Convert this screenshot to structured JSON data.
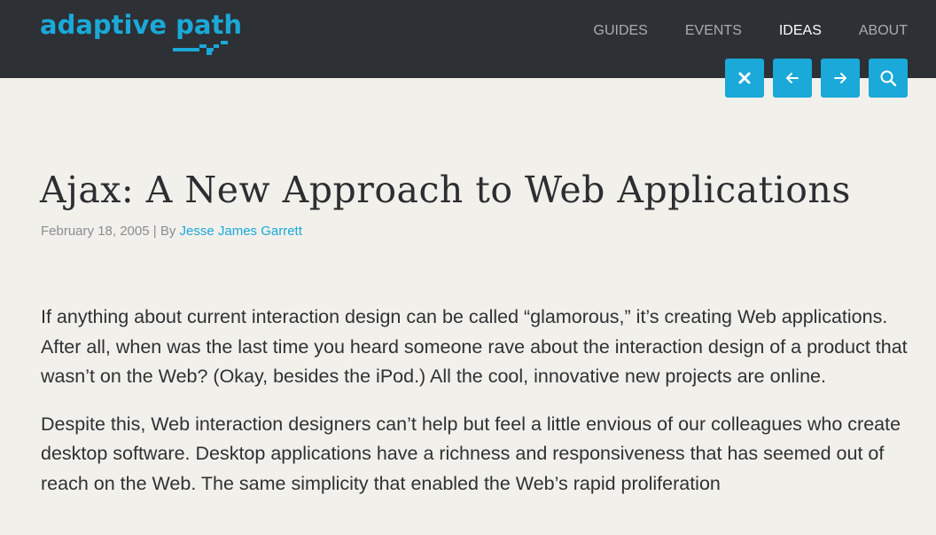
{
  "header": {
    "logo_text": "adaptive path",
    "nav": [
      {
        "label": "GUIDES",
        "active": false
      },
      {
        "label": "EVENTS",
        "active": false
      },
      {
        "label": "IDEAS",
        "active": true
      },
      {
        "label": "ABOUT",
        "active": false
      }
    ],
    "tools": [
      {
        "icon": "close-icon"
      },
      {
        "icon": "arrow-left-icon"
      },
      {
        "icon": "arrow-right-icon"
      },
      {
        "icon": "search-icon"
      }
    ]
  },
  "article": {
    "title": "Ajax: A New Approach to Web Applications",
    "date": "February 18, 2005",
    "separator": "| By",
    "author": "Jesse James Garrett",
    "paragraphs": [
      "If anything about current interaction design can be called “glamorous,” it’s creating Web applications. After all, when was the last time you heard someone rave about the interaction design of a product that wasn’t on the Web? (Okay, besides the iPod.) All the cool, innovative new projects are online.",
      "Despite this, Web interaction designers can’t help but feel a little envious of our colleagues who create desktop software. Desktop applications have a richness and responsiveness that has seemed out of reach on the Web. The same simplicity that enabled the Web’s rapid proliferation"
    ]
  },
  "colors": {
    "accent": "#1aa9d8",
    "header_bg": "#2d3035",
    "page_bg": "#f2f0eb",
    "text": "#2f3133"
  }
}
